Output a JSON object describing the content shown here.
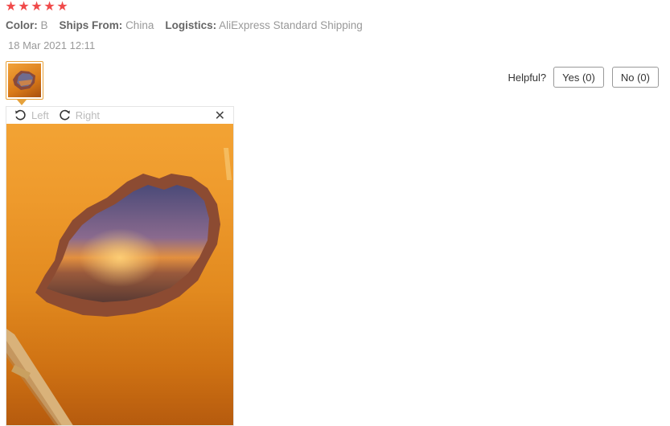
{
  "rating": {
    "stars": 5,
    "color": "#f04a4a"
  },
  "meta": {
    "color_label": "Color:",
    "color_value": "B",
    "ships_label": "Ships From:",
    "ships_value": "China",
    "logistics_label": "Logistics:",
    "logistics_value": "AliExpress Standard Shipping"
  },
  "date": "18 Mar 2021 12:11",
  "helpful": {
    "label": "Helpful?",
    "yes": "Yes (0)",
    "no": "No (0)"
  },
  "viewer": {
    "rotate_left": "Left",
    "rotate_right": "Right",
    "close_icon": "close-icon",
    "accent": "#e6a23c"
  }
}
